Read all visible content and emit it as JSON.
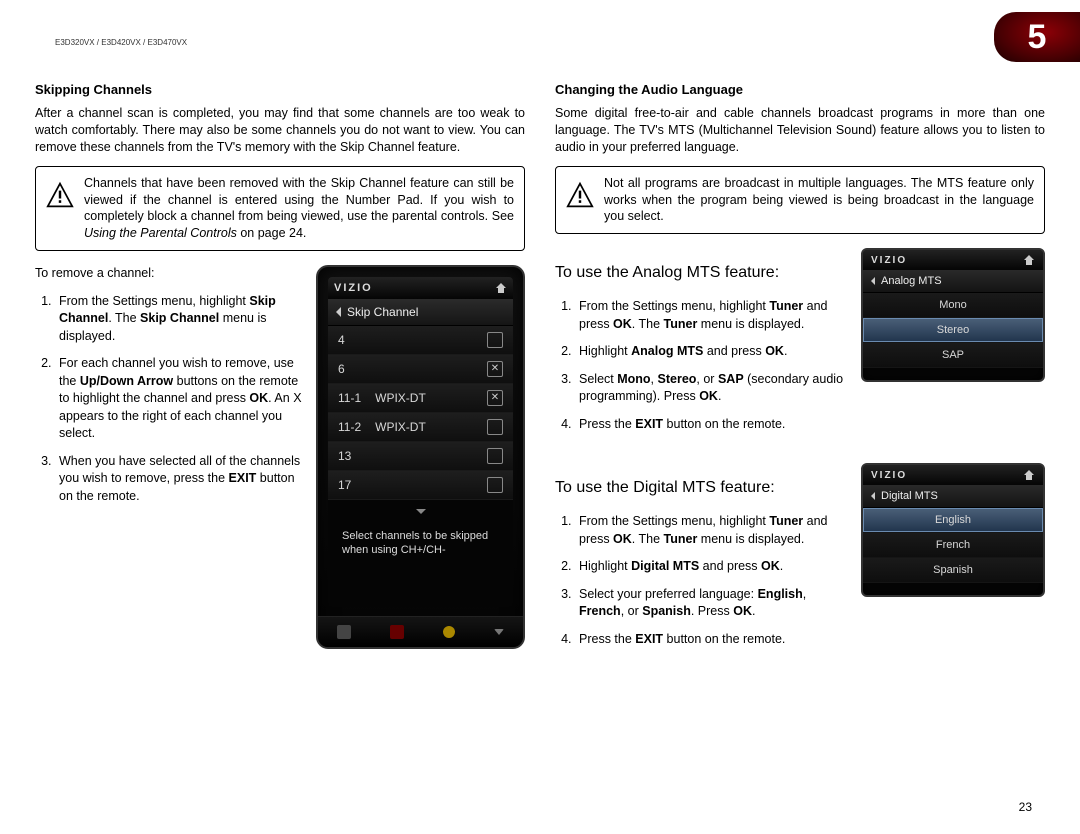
{
  "model": "E3D320VX / E3D420VX / E3D470VX",
  "chapter": "5",
  "pageNumber": "23",
  "left": {
    "heading": "Skipping Channels",
    "intro": "After a channel scan is completed, you may find that some channels are too weak to watch comfortably. There may also be some channels you do not want to view. You can remove these channels from the TV's memory with the Skip Channel feature.",
    "info_pre": "Channels that have been removed with the Skip Channel feature can still be viewed if the channel is entered using the Number Pad. If you wish to completely block a channel from being viewed, use the parental controls. See ",
    "info_italic": "Using the Parental Controls",
    "info_post": " on page 24.",
    "removeLabel": "To remove a channel:",
    "steps": {
      "s1a": "From the Settings menu, highlight ",
      "s1b": "Skip Channel",
      "s1c": ". The ",
      "s1d": "Skip Channel",
      "s1e": " menu is displayed.",
      "s2a": "For each channel you wish to remove, use the ",
      "s2b": "Up/Down Arrow",
      "s2c": " buttons on the remote to highlight the channel and press ",
      "s2d": "OK",
      "s2e": ". An X appears to the right of each channel you select.",
      "s3a": "When you have selected all of the channels you wish to remove, press the ",
      "s3b": "EXIT",
      "s3c": " button on the remote."
    }
  },
  "right": {
    "heading": "Changing the Audio Language",
    "intro": "Some digital free-to-air and cable channels broadcast programs in more than one language. The TV's MTS (Multichannel Television Sound) feature allows you to listen to audio in your preferred language.",
    "info": "Not all programs are broadcast in multiple languages. The MTS feature only works when the program being viewed is being broadcast in the language you select.",
    "analogLabel": "To use the Analog MTS feature:",
    "analogSteps": {
      "s1a": "From the Settings menu, highlight ",
      "s1b": "Tuner",
      "s1c": " and press ",
      "s1d": "OK",
      "s1e": ". The ",
      "s1f": "Tuner",
      "s1g": " menu is displayed.",
      "s2a": "Highlight ",
      "s2b": "Analog MTS",
      "s2c": " and press ",
      "s2d": "OK",
      "s2e": ".",
      "s3a": "Select ",
      "s3b": "Mono",
      "s3c": ", ",
      "s3d": "Stereo",
      "s3e": ", or ",
      "s3f": "SAP",
      "s3g": " (secondary audio programming). Press ",
      "s3h": "OK",
      "s3i": ".",
      "s4a": "Press the ",
      "s4b": "EXIT",
      "s4c": " button on the remote."
    },
    "digitalLabel": "To use the Digital MTS feature:",
    "digitalSteps": {
      "s1a": "From the Settings menu, highlight ",
      "s1b": "Tuner",
      "s1c": " and press ",
      "s1d": "OK",
      "s1e": ". The ",
      "s1f": "Tuner",
      "s1g": " menu is displayed.",
      "s2a": "Highlight ",
      "s2b": "Digital MTS",
      "s2c": " and press ",
      "s2d": "OK",
      "s2e": ".",
      "s3a": "Select your preferred language: ",
      "s3b": "English",
      "s3c": ", ",
      "s3d": "French",
      "s3e": ", or ",
      "s3f": "Spanish",
      "s3g": ". Press ",
      "s3h": "OK",
      "s3i": ".",
      "s4a": "Press the ",
      "s4b": "EXIT",
      "s4c": " button on the remote."
    }
  },
  "phone": {
    "brand": "VIZIO",
    "breadcrumb": "Skip Channel",
    "rows": [
      {
        "num": "4",
        "name": "",
        "checked": false
      },
      {
        "num": "6",
        "name": "",
        "checked": true
      },
      {
        "num": "11-1",
        "name": "WPIX-DT",
        "checked": true
      },
      {
        "num": "11-2",
        "name": "WPIX-DT",
        "checked": false
      },
      {
        "num": "13",
        "name": "",
        "checked": false
      },
      {
        "num": "17",
        "name": "",
        "checked": false
      }
    ],
    "hint": "Select channels to be skipped when using CH+/CH-"
  },
  "analogShot": {
    "brand": "VIZIO",
    "breadcrumb": "Analog MTS",
    "options": [
      "Mono",
      "Stereo",
      "SAP"
    ],
    "selected": 1
  },
  "digitalShot": {
    "brand": "VIZIO",
    "breadcrumb": "Digital MTS",
    "options": [
      "English",
      "French",
      "Spanish"
    ],
    "selected": 0
  }
}
